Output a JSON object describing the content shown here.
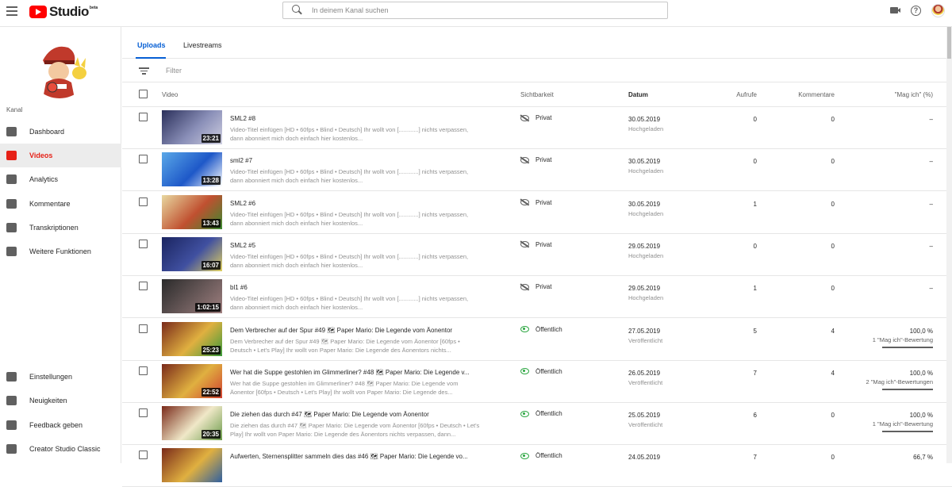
{
  "header": {
    "logo_text": "Studio",
    "logo_badge": "beta",
    "search_placeholder": "In deinem Kanal suchen"
  },
  "sidebar": {
    "channel_label": "Kanal",
    "items": [
      {
        "label": "Dashboard",
        "icon": "dashboard-icon",
        "active": false
      },
      {
        "label": "Videos",
        "icon": "videos-icon",
        "active": true
      },
      {
        "label": "Analytics",
        "icon": "analytics-icon",
        "active": false
      },
      {
        "label": "Kommentare",
        "icon": "comments-icon",
        "active": false
      },
      {
        "label": "Transkriptionen",
        "icon": "translate-icon",
        "active": false
      },
      {
        "label": "Weitere Funktionen",
        "icon": "more-features-icon",
        "active": false
      }
    ],
    "bottom_items": [
      {
        "label": "Einstellungen",
        "icon": "settings-icon"
      },
      {
        "label": "Neuigkeiten",
        "icon": "news-icon"
      },
      {
        "label": "Feedback geben",
        "icon": "feedback-icon"
      },
      {
        "label": "Creator Studio Classic",
        "icon": "classic-icon"
      }
    ]
  },
  "tabs": [
    {
      "label": "Uploads",
      "active": true
    },
    {
      "label": "Livestreams",
      "active": false
    }
  ],
  "filter_placeholder": "Filter",
  "columns": {
    "video": "Video",
    "visibility": "Sichtbarkeit",
    "date": "Datum",
    "views": "Aufrufe",
    "comments": "Kommentare",
    "likes": "\"Mag ich\" (%)"
  },
  "colors": {
    "accent_blue": "#065fd4",
    "active_red": "#e62117",
    "public_green": "#2ba640"
  },
  "rows": [
    {
      "title": "SML2 #8",
      "desc": "Video-Titel einfügen [HD • 60fps • Blind • Deutsch] Ihr wollt von [............] nichts verpassen, dann abonniert mich doch einfach hier kostenlos...",
      "duration": "23:21",
      "visibility": "Privat",
      "public": false,
      "date": "30.05.2019",
      "status": "Hochgeladen",
      "views": "0",
      "comments": "0",
      "likes": "–",
      "likes_sub": "",
      "thumb": [
        "#2a2f5a",
        "#8a8fb8",
        "#cfcfe0"
      ]
    },
    {
      "title": "sml2 #7",
      "desc": "Video-Titel einfügen [HD • 60fps • Blind • Deutsch] Ihr wollt von [............] nichts verpassen, dann abonniert mich doch einfach hier kostenlos...",
      "duration": "13:28",
      "visibility": "Privat",
      "public": false,
      "date": "30.05.2019",
      "status": "Hochgeladen",
      "views": "0",
      "comments": "0",
      "likes": "–",
      "likes_sub": "",
      "thumb": [
        "#5aa8e8",
        "#1e58c8",
        "#ffffff"
      ]
    },
    {
      "title": "SML2 #6",
      "desc": "Video-Titel einfügen [HD • 60fps • Blind • Deutsch] Ihr wollt von [............] nichts verpassen, dann abonniert mich doch einfach hier kostenlos...",
      "duration": "13:43",
      "visibility": "Privat",
      "public": false,
      "date": "30.05.2019",
      "status": "Hochgeladen",
      "views": "1",
      "comments": "0",
      "likes": "–",
      "likes_sub": "",
      "thumb": [
        "#e8d8a0",
        "#c05030",
        "#3a8a30"
      ]
    },
    {
      "title": "SML2 #5",
      "desc": "Video-Titel einfügen [HD • 60fps • Blind • Deutsch] Ihr wollt von [............] nichts verpassen, dann abonniert mich doch einfach hier kostenlos...",
      "duration": "16:07",
      "visibility": "Privat",
      "public": false,
      "date": "29.05.2019",
      "status": "Hochgeladen",
      "views": "0",
      "comments": "0",
      "likes": "–",
      "likes_sub": "",
      "thumb": [
        "#1a2460",
        "#4050a0",
        "#e0d060"
      ]
    },
    {
      "title": "bl1 #6",
      "desc": "Video-Titel einfügen [HD • 60fps • Blind • Deutsch] Ihr wollt von [............] nichts verpassen, dann abonniert mich doch einfach hier kostenlos...",
      "duration": "1:02:15",
      "visibility": "Privat",
      "public": false,
      "date": "29.05.2019",
      "status": "Hochgeladen",
      "views": "1",
      "comments": "0",
      "likes": "–",
      "likes_sub": "",
      "thumb": [
        "#2a2a2a",
        "#6a5a5a",
        "#a08080"
      ]
    },
    {
      "title": "Dem Verbrecher auf der Spur #49 🗺 Paper Mario: Die Legende vom Äonentor",
      "desc": "Dem Verbrecher auf der Spur #49 🗺 Paper Mario: Die Legende vom Äonentor [60fps • Deutsch • Let's Play] Ihr wollt von Paper Mario: Die Legende des Äonentors nichts...",
      "duration": "25:23",
      "visibility": "Öffentlich",
      "public": true,
      "date": "27.05.2019",
      "status": "Veröffentlicht",
      "views": "5",
      "comments": "4",
      "likes": "100,0 %",
      "likes_sub": "1 \"Mag ich\"-Bewertung",
      "thumb": [
        "#7a2a1a",
        "#e0b040",
        "#3a9a3a"
      ]
    },
    {
      "title": "Wer hat die Suppe gestohlen im Glimmerliner? #48 🗺 Paper Mario: Die Legende v...",
      "desc": "Wer hat die Suppe gestohlen im Glimmerliner? #48 🗺 Paper Mario: Die Legende vom Äonentor [60fps • Deutsch • Let's Play] Ihr wollt von Paper Mario: Die Legende des...",
      "duration": "22:52",
      "visibility": "Öffentlich",
      "public": true,
      "date": "26.05.2019",
      "status": "Veröffentlicht",
      "views": "7",
      "comments": "4",
      "likes": "100,0 %",
      "likes_sub": "2 \"Mag ich\"-Bewertungen",
      "thumb": [
        "#7a2a1a",
        "#e0b040",
        "#d04030"
      ]
    },
    {
      "title": "Die ziehen das durch #47 🗺 Paper Mario: Die Legende vom Äonentor",
      "desc": "Die ziehen das durch #47 🗺 Paper Mario: Die Legende vom Äonentor [60fps • Deutsch • Let's Play] Ihr wollt von Paper Mario: Die Legende des Äonentors nichts verpassen, dann...",
      "duration": "20:35",
      "visibility": "Öffentlich",
      "public": true,
      "date": "25.05.2019",
      "status": "Veröffentlicht",
      "views": "6",
      "comments": "0",
      "likes": "100,0 %",
      "likes_sub": "1 \"Mag ich\"-Bewertung",
      "thumb": [
        "#7a2a1a",
        "#f0e8c8",
        "#6a9a4a"
      ]
    },
    {
      "title": "Aufwerten, Sternensplitter sammeln dies das #46 🗺 Paper Mario: Die Legende vo...",
      "desc": "",
      "duration": "",
      "visibility": "Öffentlich",
      "public": true,
      "date": "24.05.2019",
      "status": "",
      "views": "7",
      "comments": "0",
      "likes": "66,7 %",
      "likes_sub": "",
      "thumb": [
        "#7a2a1a",
        "#e0b040",
        "#3060a0"
      ]
    }
  ]
}
